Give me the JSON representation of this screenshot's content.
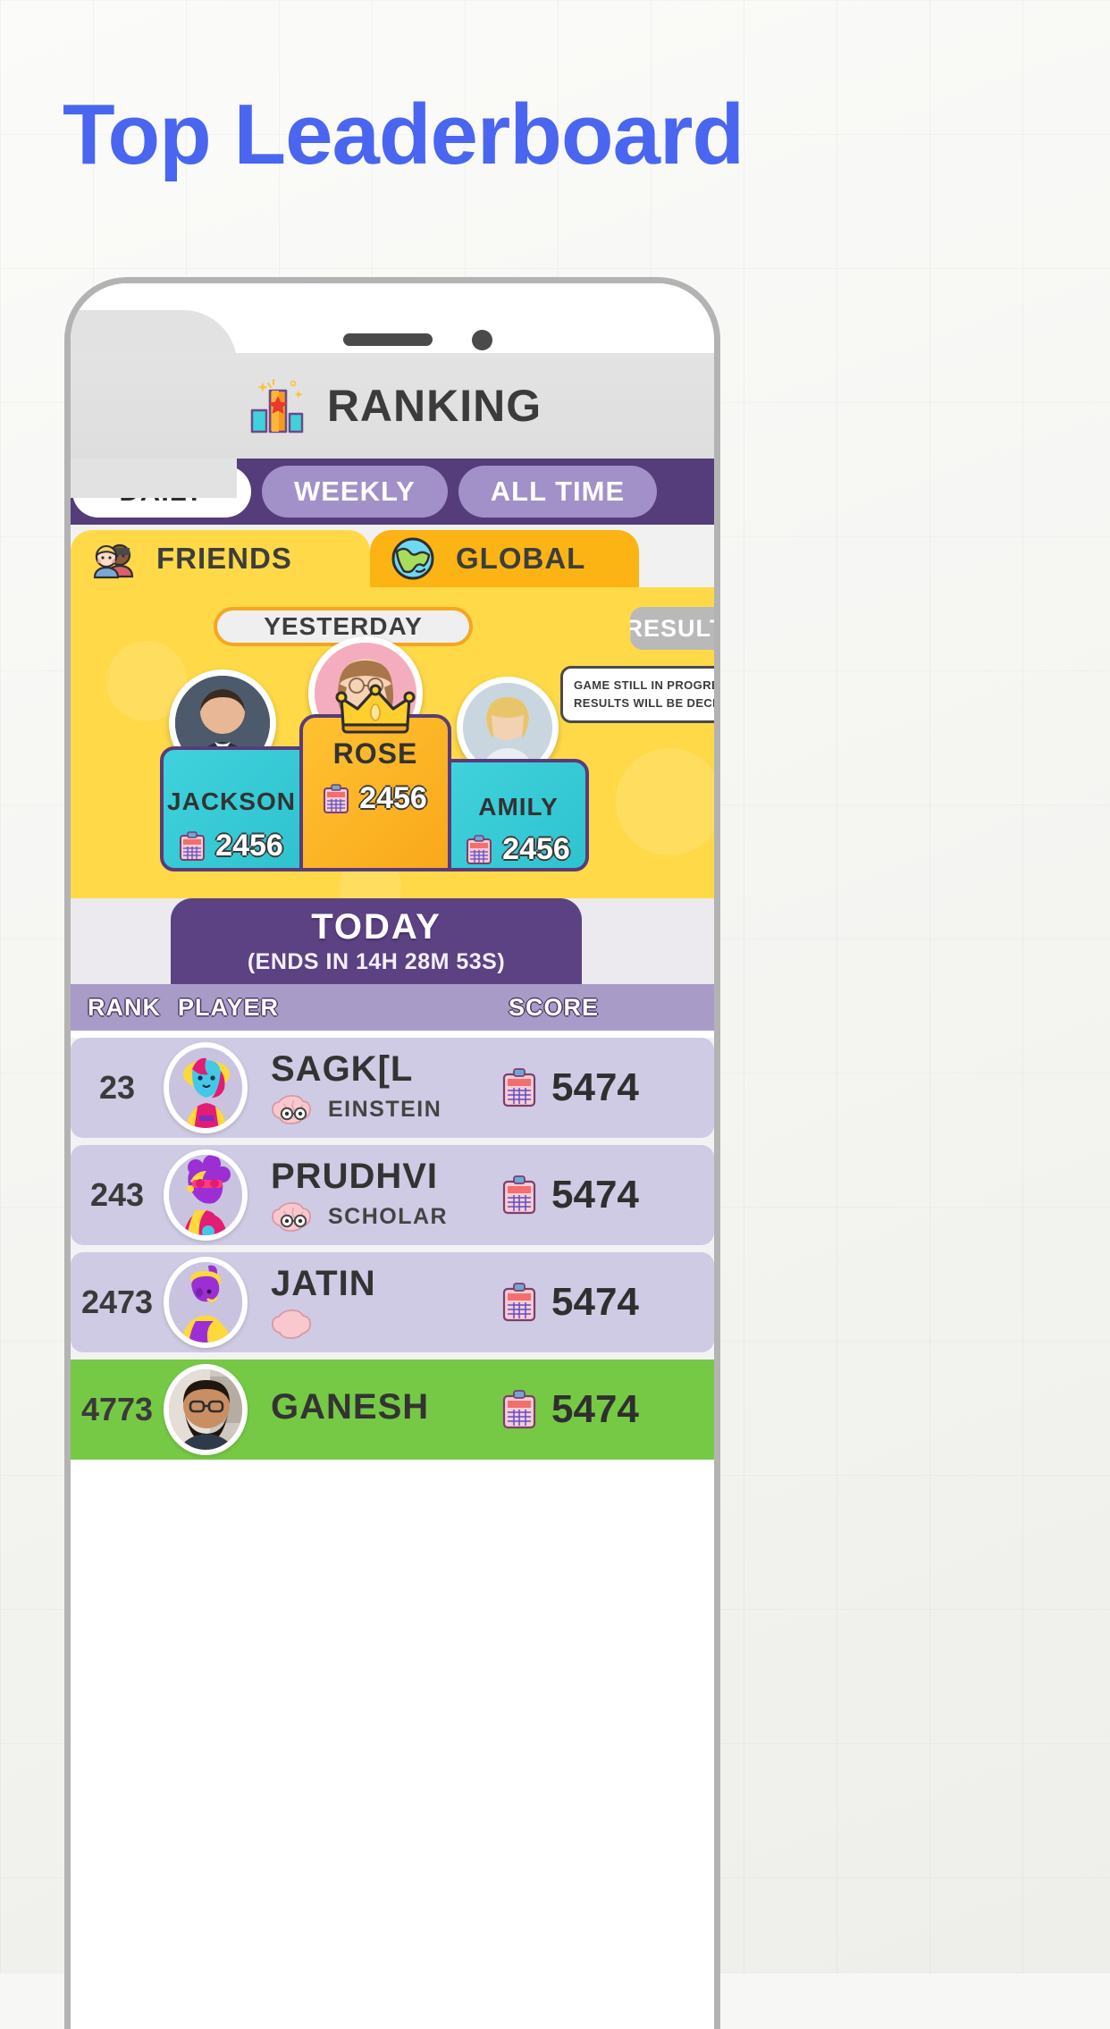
{
  "page": {
    "title": "Top Leaderboard",
    "title_color": "#4a66f0"
  },
  "app": {
    "header": {
      "title": "RANKING",
      "icon": "podium-icon"
    },
    "period_tabs": [
      {
        "label": "DAILY",
        "active": true
      },
      {
        "label": "WEEKLY",
        "active": false
      },
      {
        "label": "ALL TIME",
        "active": false
      }
    ],
    "scope_tabs": [
      {
        "label": "FRIENDS",
        "icon": "friends-icon",
        "active": true
      },
      {
        "label": "GLOBAL",
        "icon": "globe-icon",
        "active": false
      }
    ],
    "podium": {
      "period_pill": "YESTERDAY",
      "results_button": "RESULTS",
      "tooltip_line1": "GAME STILL IN PROGRESS IN SOME C",
      "tooltip_line2": "RESULTS WILL BE DECLARED",
      "winners": [
        {
          "place": 2,
          "name": "JACKSON",
          "score": "2456",
          "card_color": "#3fd2dd",
          "crown": false
        },
        {
          "place": 1,
          "name": "ROSE",
          "score": "2456",
          "card_color": "#fcb51b",
          "crown": true
        },
        {
          "place": 3,
          "name": "AMILY",
          "score": "2456",
          "card_color": "#3fd2dd",
          "crown": false
        }
      ]
    },
    "today": {
      "label": "TODAY",
      "countdown": "(ENDS IN  14H 28M 53S)"
    },
    "table": {
      "columns": {
        "rank": "RANK",
        "player": "PLAYER",
        "score": "SCORE"
      },
      "rows": [
        {
          "rank": "23",
          "name": "SAGK[L",
          "badge": "EINSTEIN",
          "score": "5474",
          "highlight": false,
          "avatar": "avatar-sagkil"
        },
        {
          "rank": "243",
          "name": "PRUDHVI",
          "badge": "SCHOLAR",
          "score": "5474",
          "highlight": false,
          "avatar": "avatar-prudhvi"
        },
        {
          "rank": "2473",
          "name": "JATIN",
          "badge": "",
          "score": "5474",
          "highlight": false,
          "avatar": "avatar-jatin"
        },
        {
          "rank": "4773",
          "name": "GANESH",
          "badge": "",
          "score": "5474",
          "highlight": true,
          "avatar": "avatar-ganesh"
        }
      ]
    },
    "colors": {
      "period_bar": "#543d7a",
      "friends_tab": "#ffd948",
      "global_tab": "#fcb415",
      "podium_bg": "#ffd948",
      "today_banner": "#5c4183",
      "table_header": "#a99bc8",
      "row_bg": "#cfcbe4",
      "row_highlight": "#76c945"
    }
  }
}
